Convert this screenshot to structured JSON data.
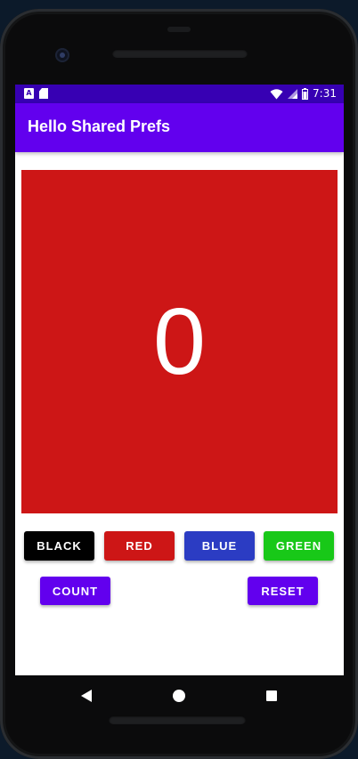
{
  "status_bar": {
    "time": "7:31",
    "left_icons": [
      "a-icon",
      "sd-card-icon"
    ],
    "right_icons": [
      "wifi-icon",
      "cellular-icon",
      "battery-icon"
    ],
    "a_icon_text": "A"
  },
  "app_bar": {
    "title": "Hello Shared Prefs"
  },
  "count_display": {
    "value": "0",
    "background_color": "#cd1616"
  },
  "color_buttons": [
    {
      "label": "BLACK",
      "color": "#000000"
    },
    {
      "label": "RED",
      "color": "#cd1616"
    },
    {
      "label": "BLUE",
      "color": "#2b3cc3"
    },
    {
      "label": "GREEN",
      "color": "#18c818"
    }
  ],
  "action_buttons": {
    "count": "COUNT",
    "reset": "RESET"
  },
  "nav_bar": {
    "icons": [
      "back-icon",
      "home-icon",
      "recents-icon"
    ]
  },
  "theme": {
    "primary": "#6200ee",
    "primary_dark": "#3700b3"
  }
}
